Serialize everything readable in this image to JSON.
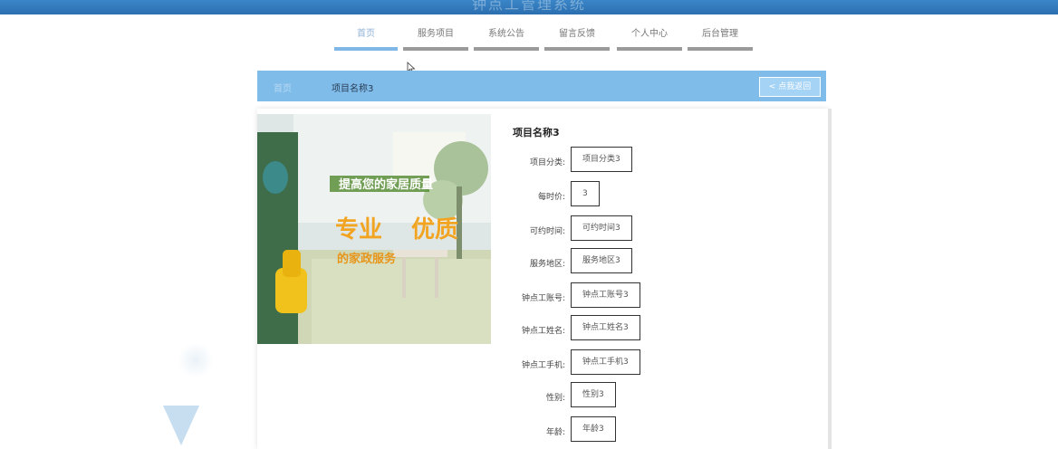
{
  "header": {
    "site_title": "钟点工管理系统"
  },
  "nav": {
    "items": [
      {
        "label": "首页",
        "active": true
      },
      {
        "label": "服务项目",
        "active": false
      },
      {
        "label": "系统公告",
        "active": false
      },
      {
        "label": "留言反馈",
        "active": false
      },
      {
        "label": "个人中心",
        "active": false
      },
      {
        "label": "后台管理",
        "active": false
      }
    ]
  },
  "card": {
    "home_link": "首页",
    "title": "项目名称3",
    "back_button": "< 点我返回"
  },
  "detail": {
    "title": "项目名称3",
    "fields": [
      {
        "label": "项目分类:",
        "value": "项目分类3"
      },
      {
        "label": "每时价:",
        "value": "3"
      },
      {
        "label": "可约时间:",
        "value": "可约时间3"
      },
      {
        "label": "服务地区:",
        "value": "服务地区3"
      },
      {
        "label": "钟点工账号:",
        "value": "钟点工账号3"
      },
      {
        "label": "钟点工姓名:",
        "value": "钟点工姓名3"
      },
      {
        "label": "钟点工手机:",
        "value": "钟点工手机3"
      },
      {
        "label": "性别:",
        "value": "性别3"
      },
      {
        "label": "年龄:",
        "value": "年龄3"
      }
    ]
  },
  "banner": {
    "headline": "提高您的家居质量",
    "slogan_1": "专业",
    "slogan_2": "优质",
    "subtext": "的家政服务"
  },
  "colors": {
    "accent": "#7fbcea",
    "topbar": "#2c6fb0"
  }
}
